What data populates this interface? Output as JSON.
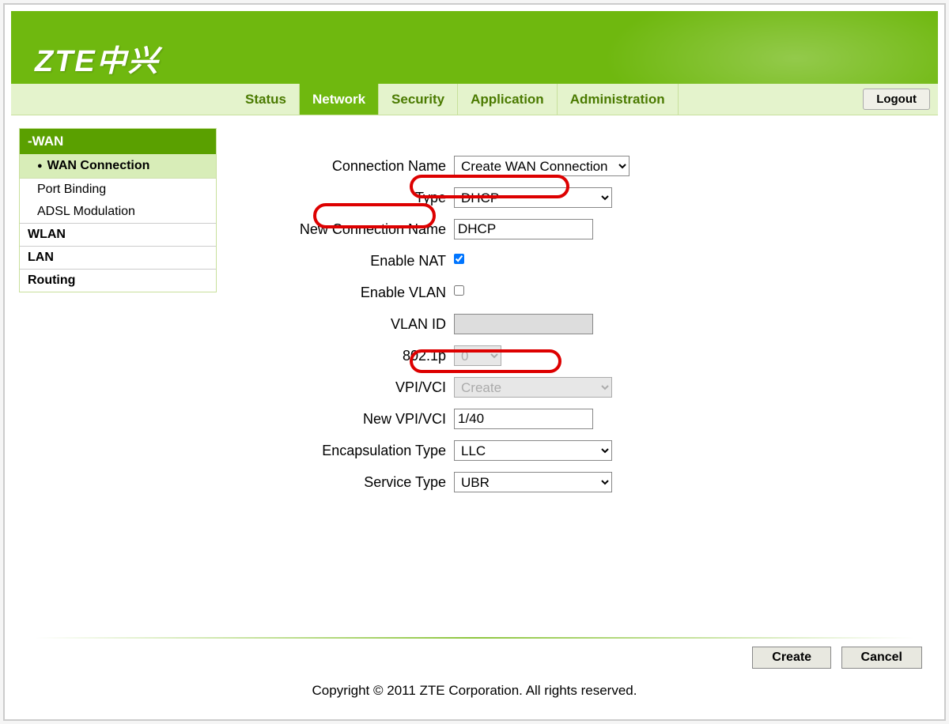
{
  "logo": "ZTE中兴",
  "nav": {
    "tabs": [
      "Status",
      "Network",
      "Security",
      "Application",
      "Administration"
    ],
    "active": "Network",
    "logout": "Logout"
  },
  "sidebar": {
    "group_header": "-WAN",
    "items": [
      "WAN Connection",
      "Port Binding",
      "ADSL Modulation"
    ],
    "groups": [
      "WLAN",
      "LAN",
      "Routing"
    ]
  },
  "form": {
    "labels": {
      "conn_name": "Connection Name",
      "type": "Type",
      "new_conn": "New Connection Name",
      "enable_nat": "Enable NAT",
      "enable_vlan": "Enable VLAN",
      "vlan_id": "VLAN ID",
      "p8021": "802.1p",
      "vpi_vci": "VPI/VCI",
      "new_vpi_vci": "New VPI/VCI",
      "encap": "Encapsulation Type",
      "service": "Service Type"
    },
    "values": {
      "conn_name": "Create WAN Connection",
      "type": "DHCP",
      "new_conn": "DHCP",
      "enable_nat": true,
      "enable_vlan": false,
      "vlan_id": "",
      "p8021": "0",
      "vpi_vci": "Create",
      "new_vpi_vci": "1/40",
      "encap": "LLC",
      "service": "UBR"
    }
  },
  "buttons": {
    "create": "Create",
    "cancel": "Cancel"
  },
  "copyright": "Copyright © 2011 ZTE Corporation. All rights reserved."
}
